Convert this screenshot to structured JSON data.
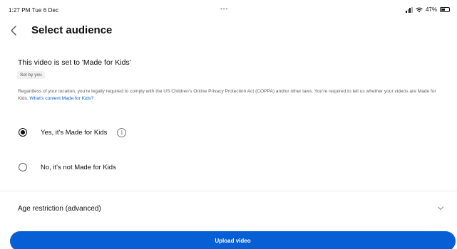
{
  "status_bar": {
    "time_date": "1:27 PM  Tue 6 Dec",
    "dots": "•••",
    "battery_percent": "47%",
    "battery_level": 0.47
  },
  "header": {
    "title": "Select audience"
  },
  "audience": {
    "heading": "This video is set to 'Made for Kids'",
    "set_by": "Set by you",
    "legal_text": "Regardless of your location, you're legally required to comply with the US Children's Online Privacy Protection Act (COPPA) and/or other laws. You're required to tell us whether your videos are Made for Kids.",
    "legal_link": "What's content Made for Kids?",
    "options": [
      {
        "label": "Yes, it's Made for Kids",
        "selected": true
      },
      {
        "label": "No, it's not Made for Kids",
        "selected": false
      }
    ]
  },
  "age_restriction": {
    "label": "Age restriction (advanced)"
  },
  "footer": {
    "upload_label": "Upload video"
  },
  "colors": {
    "accent": "#065fd4",
    "text": "#0f0f0f",
    "secondary_text": "#606060"
  },
  "icons": {
    "back": "back-arrow-icon",
    "info": "info-icon",
    "expand": "chevron-down-icon",
    "signal": "signal-icon",
    "wifi": "wifi-icon",
    "battery": "battery-icon"
  }
}
